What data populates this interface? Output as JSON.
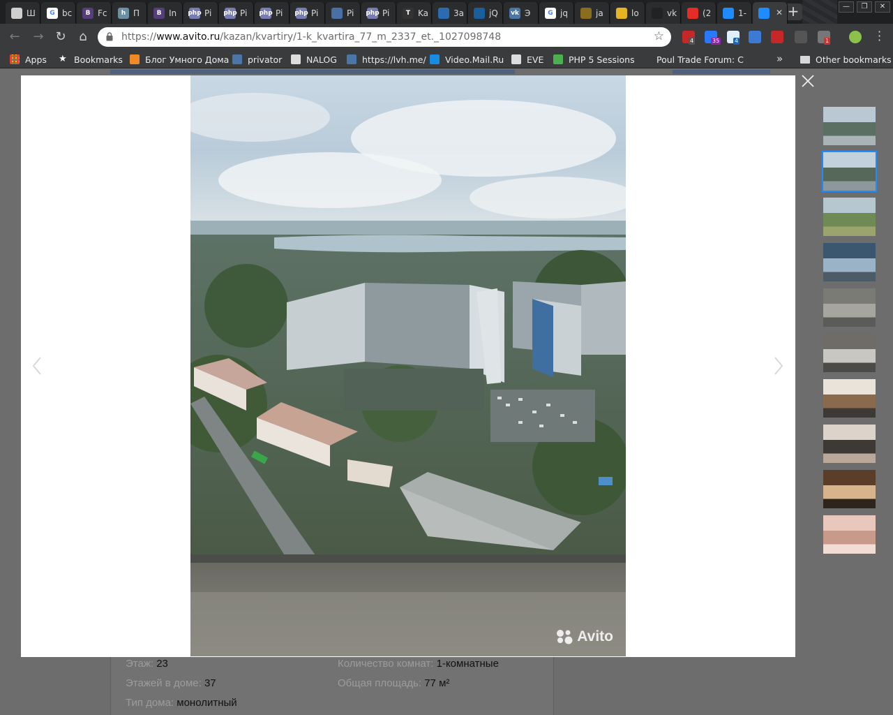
{
  "tabs": [
    {
      "title": "Ш",
      "icon": "document-icon",
      "color": "#cfcfcf",
      "glyph": ""
    },
    {
      "title": "bc",
      "icon": "google-icon",
      "color": "#ffffff",
      "glyph": "G"
    },
    {
      "title": "Fc",
      "icon": "bootstrap-icon",
      "color": "#563d7c",
      "glyph": "B"
    },
    {
      "title": "П",
      "icon": "habr-icon",
      "color": "#6b8fa3",
      "glyph": "h"
    },
    {
      "title": "In",
      "icon": "bootstrap-icon",
      "color": "#563d7c",
      "glyph": "B"
    },
    {
      "title": "Pi",
      "icon": "php-icon",
      "color": "#787cb4",
      "glyph": "php"
    },
    {
      "title": "Pi",
      "icon": "php-icon",
      "color": "#787cb4",
      "glyph": "php"
    },
    {
      "title": "Pi",
      "icon": "php-icon",
      "color": "#787cb4",
      "glyph": "php"
    },
    {
      "title": "Pi",
      "icon": "php-icon",
      "color": "#787cb4",
      "glyph": "php"
    },
    {
      "title": "Pi",
      "icon": "eye-icon",
      "color": "#4a6fa5",
      "glyph": ""
    },
    {
      "title": "Pi",
      "icon": "php-icon",
      "color": "#787cb4",
      "glyph": "php"
    },
    {
      "title": "Ka",
      "icon": "tilda-icon",
      "color": "#333333",
      "glyph": "T"
    },
    {
      "title": "3a",
      "icon": "calendar-icon",
      "color": "#2b6cb0",
      "glyph": ""
    },
    {
      "title": "jQ",
      "icon": "jquery-icon",
      "color": "#1b5e9c",
      "glyph": ""
    },
    {
      "title": "Э",
      "icon": "vk-icon",
      "color": "#4a76a8",
      "glyph": "vk"
    },
    {
      "title": "jq",
      "icon": "google-icon",
      "color": "#ffffff",
      "glyph": "G"
    },
    {
      "title": "ja",
      "icon": "glasses-icon",
      "color": "#8a6d1d",
      "glyph": ""
    },
    {
      "title": "lo",
      "icon": "chart-icon",
      "color": "#e6b422",
      "glyph": ""
    },
    {
      "title": "vk",
      "icon": "github-icon",
      "color": "#222222",
      "glyph": ""
    },
    {
      "title": "(2",
      "icon": "youtube-icon",
      "color": "#e52d27",
      "glyph": ""
    },
    {
      "title": "1-",
      "icon": "avito-icon",
      "color": "#1e8bff",
      "glyph": ""
    },
    {
      "title": "",
      "icon": "avito-icon",
      "color": "#1e8bff",
      "glyph": ""
    }
  ],
  "active_tab_index": 21,
  "address_bar": {
    "protocol": "https://",
    "host": "www.avito.ru",
    "path": "/kazan/kvartiry/1-k_kvartira_77_m_2337_et._1027098748"
  },
  "extensions": [
    {
      "name": "adblock-icon",
      "color": "#c62828",
      "badge": "4",
      "badge_color": "#555555"
    },
    {
      "name": "puzzle-extension-icon",
      "color": "#2979ff",
      "badge": "35",
      "badge_color": "#8e24aa"
    },
    {
      "name": "cloud-extension-icon",
      "color": "#e0f0ff",
      "badge": "4",
      "badge_color": "#1565c0"
    },
    {
      "name": "translate-icon",
      "color": "#3d7ad6",
      "badge": "",
      "badge_color": ""
    },
    {
      "name": "pdf-icon",
      "color": "#c62828",
      "badge": "",
      "badge_color": ""
    },
    {
      "name": "grey-extension-icon",
      "color": "#555555",
      "badge": "",
      "badge_color": ""
    },
    {
      "name": "shield-extension-icon",
      "color": "#777777",
      "badge": "1",
      "badge_color": "#d32f2f"
    },
    {
      "name": "profile-icon",
      "color": "#8bc34a",
      "badge": "",
      "badge_color": ""
    }
  ],
  "bookmarks": [
    {
      "label": "Apps",
      "icon": "apps-grid-icon",
      "color": "#e94235"
    },
    {
      "label": "Bookmarks",
      "icon": "star-icon",
      "color": "#ffffff"
    },
    {
      "label": "Блог Умного Дома",
      "icon": "rss-icon",
      "color": "#f08a24"
    },
    {
      "label": "privator",
      "icon": "vk-icon",
      "color": "#4a76a8"
    },
    {
      "label": "NALOG",
      "icon": "document-icon",
      "color": "#dddddd"
    },
    {
      "label": "https://lvh.me/",
      "icon": "vk-icon",
      "color": "#4a76a8"
    },
    {
      "label": "Video.Mail.Ru",
      "icon": "mail-video-icon",
      "color": "#168de2"
    },
    {
      "label": "EVE",
      "icon": "document-icon",
      "color": "#dddddd"
    },
    {
      "label": "PHP 5 Sessions",
      "icon": "w3schools-icon",
      "color": "#4caf50"
    },
    {
      "label": "Poul Trade Forum: C",
      "icon": "",
      "color": ""
    }
  ],
  "bookmarks_more": "»",
  "other_bookmarks": "Other bookmarks",
  "page": {
    "params": [
      {
        "key": "Этаж: ",
        "value": "23"
      },
      {
        "key": "Количество комнат: ",
        "value": "1-комнатные"
      },
      {
        "key": "Этажей в доме: ",
        "value": "37"
      },
      {
        "key": "Общая площадь: ",
        "value": "77 м²"
      },
      {
        "key": "Тип дома: ",
        "value": "монолитный"
      }
    ]
  },
  "gallery": {
    "watermark": "Avito",
    "selected_index": 1,
    "thumbnails": [
      {
        "name": "thumb-city-view-1"
      },
      {
        "name": "thumb-city-view-2"
      },
      {
        "name": "thumb-field-view"
      },
      {
        "name": "thumb-window-view"
      },
      {
        "name": "thumb-concrete-room"
      },
      {
        "name": "thumb-bare-wall"
      },
      {
        "name": "thumb-lobby"
      },
      {
        "name": "thumb-door"
      },
      {
        "name": "thumb-corridor-1"
      },
      {
        "name": "thumb-corridor-2"
      }
    ]
  }
}
